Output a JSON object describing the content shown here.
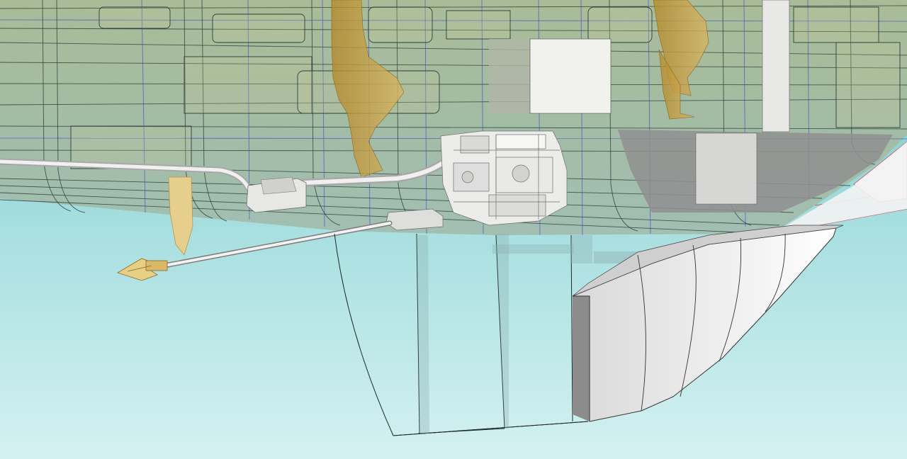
{
  "scene": {
    "colors": {
      "water_top": "#7fcfcf",
      "water_bottom": "#c9eeee",
      "hull_tint": "#b8b88a",
      "hull_outline": "#2e3d3d",
      "station_line": "#3333cc",
      "waterline_red": "#d0405a",
      "figure_tan": "#c9a64a",
      "machinery_white": "#eeeeea",
      "keel_face": "#f4f4f4",
      "keel_shadow": "#8b8b8b",
      "deck_grey": "#8f9090"
    }
  }
}
